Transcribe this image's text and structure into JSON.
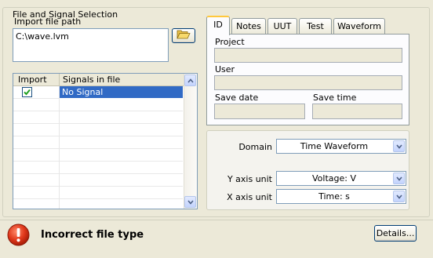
{
  "group": {
    "title": "File and Signal Selection"
  },
  "import": {
    "label": "Import file path",
    "path_value": "C:\\wave.lvm",
    "browse_icon": "folder-open-icon"
  },
  "signals_table": {
    "columns": [
      "Import",
      "Signals in file"
    ],
    "rows": [
      {
        "checked": true,
        "name": "No Signal",
        "selected": true
      }
    ]
  },
  "tabs": {
    "items": [
      "ID",
      "Notes",
      "UUT",
      "Test",
      "Waveform"
    ],
    "active": "ID",
    "id_tab": {
      "project_label": "Project",
      "user_label": "User",
      "save_date_label": "Save date",
      "save_time_label": "Save time"
    }
  },
  "settings": {
    "domain_label": "Domain",
    "domain_value": "Time Waveform",
    "y_axis_label": "Y axis unit",
    "y_axis_value": "Voltage: V",
    "x_axis_label": "X axis unit",
    "x_axis_value": "Time: s"
  },
  "status": {
    "icon": "error-icon",
    "message": "Incorrect file type",
    "details_label": "Details...",
    "colors": {
      "error": "#d42a10",
      "selection": "#316ac5",
      "tab_highlight": "#ffc83c"
    }
  }
}
